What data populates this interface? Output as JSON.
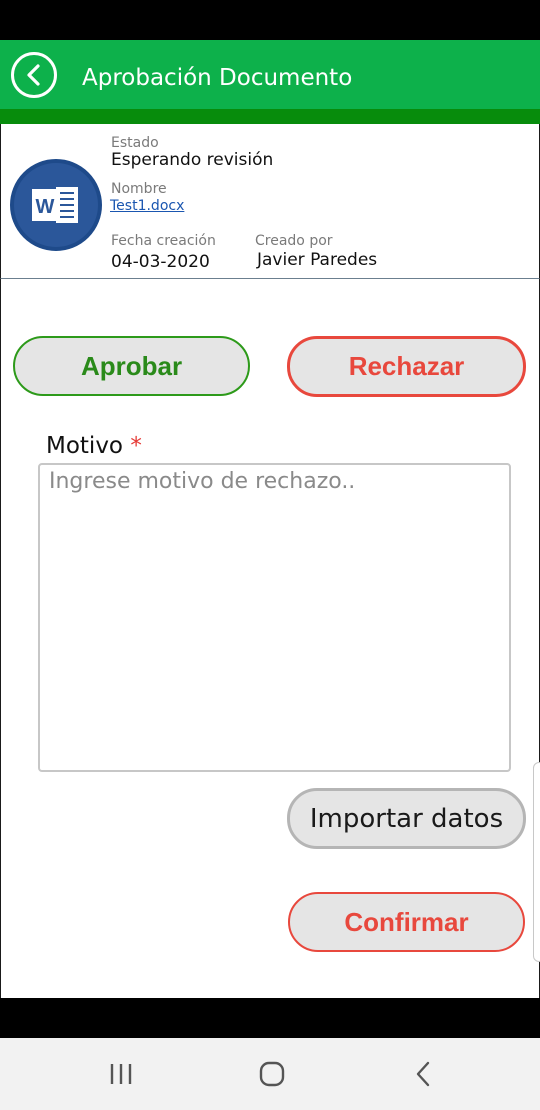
{
  "header": {
    "title": "Aprobación Documento",
    "back_icon": "back-chevron-circle-icon",
    "color": "#0db14b"
  },
  "document": {
    "icon": "word-document-icon",
    "estado_label": "Estado",
    "estado_value": "Esperando revisión",
    "nombre_label": "Nombre",
    "nombre_value": "Test1.docx",
    "fecha_label": "Fecha creación",
    "fecha_value": "04-03-2020",
    "creado_label": "Creado por",
    "creado_value": "Javier Paredes"
  },
  "actions": {
    "aprobar": "Aprobar",
    "rechazar": "Rechazar",
    "importar": "Importar datos",
    "confirmar": "Confirmar"
  },
  "motivo": {
    "label": "Motivo",
    "required_mark": "*",
    "placeholder": "Ingrese motivo de rechazo..",
    "value": ""
  },
  "colors": {
    "approve": "#2a8a1a",
    "reject": "#e8483d",
    "word_blue": "#2b579a"
  },
  "navbar": {
    "recent_icon": "recent-apps-icon",
    "home_icon": "home-icon",
    "back_icon": "back-icon"
  }
}
